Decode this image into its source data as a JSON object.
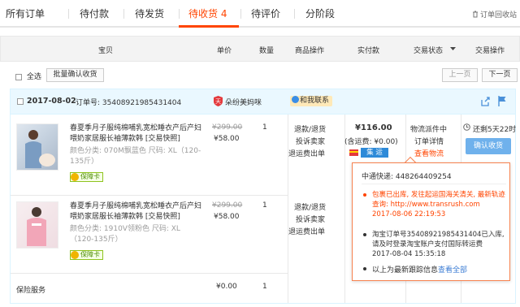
{
  "tabs": [
    {
      "label": "所有订单"
    },
    {
      "label": "待付款"
    },
    {
      "label": "待发货"
    },
    {
      "label": "待收货 4"
    },
    {
      "label": "待评价"
    },
    {
      "label": "分阶段"
    }
  ],
  "recycle_label": "订单回收站",
  "columns": {
    "item": "宝贝",
    "price": "单价",
    "qty": "数量",
    "ops": "商品操作",
    "paid": "实付款",
    "status": "交易状态",
    "action": "交易操作"
  },
  "toolbar": {
    "select_all": "全选",
    "batch_confirm": "批量确认收货",
    "prev": "上一页",
    "next": "下一页"
  },
  "order": {
    "date": "2017-08-02",
    "order_no_label": "订单号: 35408921985431404",
    "shop_name": "朵纷美妈咪",
    "contact": "和我联系",
    "items": [
      {
        "title": "春夏季月子服纯棉哺乳宽松睡衣产后产妇喂奶家居服长袖薄款韩 [交易快照]",
        "spec": "颜色分类: 070M飘蓝色  尺码: XL（120-135斤）",
        "badge": "保障卡",
        "orig_price": "¥299.00",
        "price": "¥58.00",
        "qty": "1",
        "ops": [
          "退款/退货",
          "投诉卖家",
          "退运费出单"
        ]
      },
      {
        "title": "春夏季月子服纯棉哺乳宽松睡衣产后产妇喂奶家居服长袖薄款韩 [交易快照]",
        "spec": "颜色分类: 1910V领粉色  尺码: XL（120-135斤）",
        "badge": "保障卡",
        "orig_price": "¥299.00",
        "price": "¥58.00",
        "qty": "1",
        "ops": [
          "退款/退货",
          "投诉卖家",
          "退运费出单"
        ]
      }
    ],
    "insurance_label": "保险服务",
    "insurance_price": "¥0.00",
    "insurance_qty": "1",
    "total": "¥116.00",
    "shipping": "(含运费: ¥0.00)",
    "ship_tag": "集 运",
    "status_lines": [
      "物流派件中",
      "订单详情",
      "查看物流"
    ],
    "countdown": "还剩5天22时",
    "confirm_button": "确认收货"
  },
  "tracking": {
    "company": "中通快递: 448264409254",
    "events": [
      {
        "text": "包裹已出库, 发往起运国海关清关, 最新轨迹查询: http://www.transrush.com",
        "time": "2017-08-06 22:19:53"
      },
      {
        "text": "淘宝订单号35408921985431404已入库, 请及时登录淘宝账户支付国际转运费",
        "time": "2017-08-04 15:35:18"
      }
    ],
    "footer_prefix": "以上为最新跟踪信息",
    "footer_link": "查看全部"
  },
  "colors": {
    "accent": "#ff4400",
    "link": "#3c7dd4",
    "button_blue": "#6fb1ec",
    "order_head_bg": "#eaf8ff"
  },
  "icons": [
    "trash-icon",
    "shop-badge-icon",
    "chat-icon",
    "share-icon",
    "flag-icon",
    "clock-icon"
  ]
}
